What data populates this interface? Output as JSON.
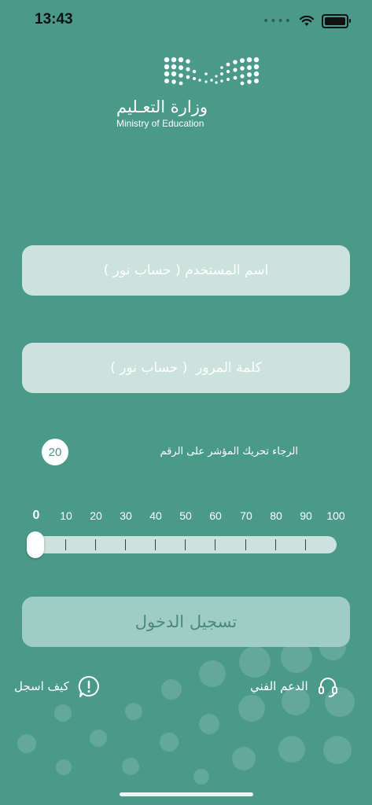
{
  "status_bar": {
    "time": "13:43",
    "icons": [
      "signal-dots-icon",
      "wifi-icon",
      "battery-icon"
    ]
  },
  "logo": {
    "arabic_name": "وزارة التعـليم",
    "english_name": "Ministry of Education"
  },
  "login_form": {
    "username_placeholder": "اسم المستخدم ( حساب نور )",
    "password_placeholder": "كلمة المرور  ( حساب نور )"
  },
  "slider": {
    "hint": "الرجاء تحريك المؤشر على الرقم",
    "target_value": "20",
    "current_value": 0,
    "min": 0,
    "max": 100,
    "tick_labels": [
      "0",
      "10",
      "20",
      "30",
      "40",
      "50",
      "60",
      "70",
      "80",
      "90",
      "100"
    ]
  },
  "login_button": {
    "label": "تسجيل الدخول"
  },
  "links": {
    "support_label": "الدعم الفني",
    "how_to_register_label": "كيف اسجل"
  },
  "colors": {
    "background": "#4a9a8a",
    "field_background": "#cbe3dc",
    "button_background": "#9fcdc5",
    "button_text": "#4a8a7c"
  }
}
